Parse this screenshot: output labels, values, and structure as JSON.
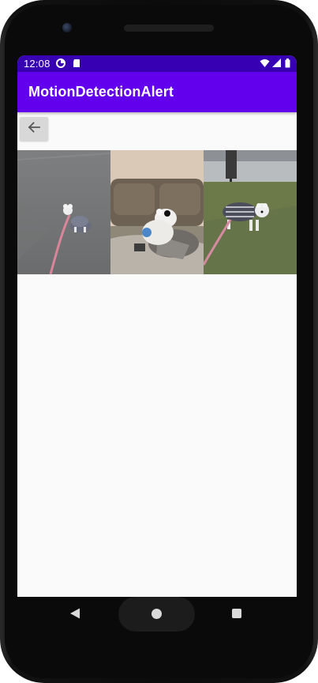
{
  "status_bar": {
    "time": "12:08",
    "icons": [
      "data-saver-icon",
      "sd-card-icon",
      "wifi-icon",
      "cell-signal-icon",
      "battery-icon"
    ],
    "background": "#3700b3"
  },
  "app_bar": {
    "title": "MotionDetectionAlert",
    "background": "#6200ee"
  },
  "toolbar": {
    "back_icon": "arrow-back-icon"
  },
  "gallery": {
    "photos": [
      {
        "name": "photo-dog-walking-on-asphalt"
      },
      {
        "name": "photo-dog-on-sofa"
      },
      {
        "name": "photo-dog-on-green-ground"
      }
    ]
  },
  "nav_bar": {
    "icons": [
      "nav-back-icon",
      "nav-home-icon",
      "nav-recent-icon"
    ]
  }
}
